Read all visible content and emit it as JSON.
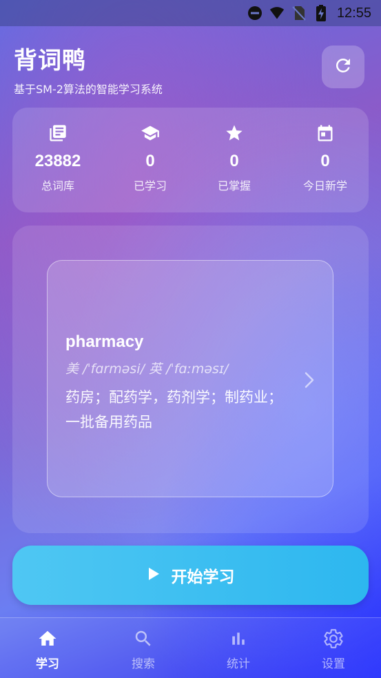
{
  "status_bar": {
    "time": "12:55"
  },
  "header": {
    "title": "背词鸭",
    "subtitle": "基于SM-2算法的智能学习系统"
  },
  "stats": [
    {
      "value": "23882",
      "label": "总词库",
      "icon": "book-icon"
    },
    {
      "value": "0",
      "label": "已学习",
      "icon": "graduation-cap-icon"
    },
    {
      "value": "0",
      "label": "已掌握",
      "icon": "star-icon"
    },
    {
      "value": "0",
      "label": "今日新学",
      "icon": "calendar-icon"
    }
  ],
  "word_card": {
    "word": "pharmacy",
    "phonetic": "美 /ˈfɑrməsi/  英 /ˈfɑːməsɪ/",
    "definition": "药房；配药学，药剂学；制药业；一批备用药品"
  },
  "start_button": {
    "label": "开始学习"
  },
  "bottom_nav": [
    {
      "label": "学习",
      "icon": "home-icon",
      "active": true
    },
    {
      "label": "搜索",
      "icon": "search-icon",
      "active": false
    },
    {
      "label": "统计",
      "icon": "bar-chart-icon",
      "active": false
    },
    {
      "label": "设置",
      "icon": "gear-icon",
      "active": false
    }
  ],
  "colors": {
    "start_button": "#3dbef1",
    "status_bar_text": "#111111"
  }
}
